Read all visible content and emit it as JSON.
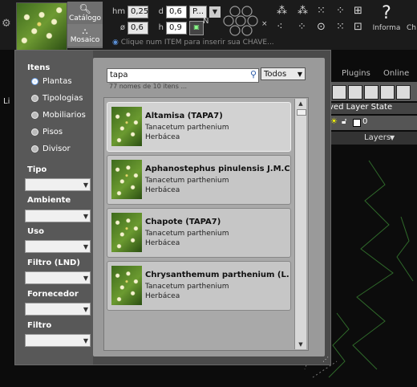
{
  "toolbar": {
    "catalogo_label": "Catálogo",
    "mosaico_label": "Mosaico",
    "fields": [
      {
        "label": "hm",
        "value": "0,25",
        "label2": "d",
        "value2": "0,6",
        "select": "P..."
      },
      {
        "label": "ø",
        "value": "0,6",
        "label2": "h",
        "value2": "0,9"
      }
    ],
    "n_label": "N",
    "hint_text": "Clique num ITEM para inserir sua CHAVE...",
    "informa_label": "Informa",
    "ch_label": "Ch"
  },
  "background": {
    "ribbon_tabs": [
      "Plugins",
      "Online"
    ],
    "layer_state": "ved Layer State",
    "layer_value": "0",
    "layers_label": "Layers",
    "left_stub": "Li"
  },
  "sidebar": {
    "itens_title": "Itens",
    "items": [
      {
        "label": "Plantas",
        "selected": true
      },
      {
        "label": "Tipologias",
        "selected": false
      },
      {
        "label": "Mobiliarios",
        "selected": false
      },
      {
        "label": "Pisos",
        "selected": false
      },
      {
        "label": "Divisor",
        "selected": false
      }
    ],
    "filters": [
      {
        "label": "Tipo",
        "value": ""
      },
      {
        "label": "Ambiente",
        "value": ""
      },
      {
        "label": "Uso",
        "value": ""
      },
      {
        "label": "Filtro (LND)",
        "value": ""
      },
      {
        "label": "Fornecedor",
        "value": ""
      },
      {
        "label": "Filtro",
        "value": ""
      }
    ]
  },
  "main": {
    "search_value": "tapa",
    "search_placeholder": "",
    "filter_select": "Todos",
    "count_text": "77 nomes de 10 itens ...",
    "results": [
      {
        "title": "Altamisa (TAPA7)",
        "species": "Tanacetum parthenium",
        "category": "Herbácea",
        "selected": true
      },
      {
        "title": "Aphanostephus pinulensis J.M.Coult. (",
        "species": "Tanacetum parthenium",
        "category": "Herbácea",
        "selected": false
      },
      {
        "title": "Chapote (TAPA7)",
        "species": "Tanacetum parthenium",
        "category": "Herbácea",
        "selected": false
      },
      {
        "title": "Chrysanthemum parthenium (L.) Bern",
        "species": "Tanacetum parthenium",
        "category": "Herbácea",
        "selected": false
      }
    ]
  },
  "colors": {
    "accent": "#2a5aa8",
    "panel": "#9a9a9a",
    "sidebar": "#585858"
  }
}
